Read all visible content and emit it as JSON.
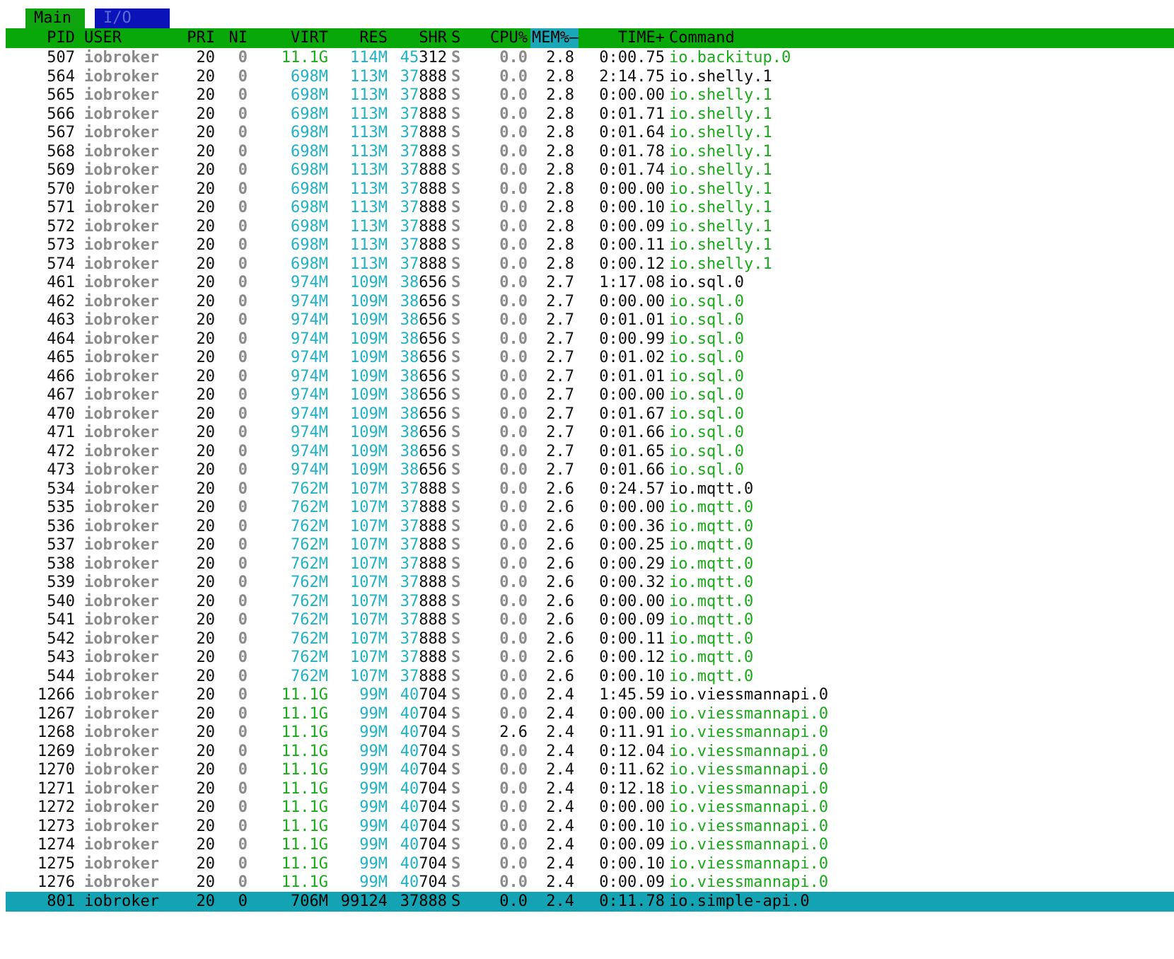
{
  "tabs": {
    "main": "Main",
    "io": "I/O"
  },
  "header": {
    "pid": "PID",
    "user": "USER",
    "pri": "PRI",
    "ni": "NI",
    "virt": "VIRT",
    "res": "RES",
    "shr": "SHR",
    "s": "S",
    "cpu": "CPU%",
    "mem": "MEM%",
    "mem_sort": "–",
    "time": "TIME+",
    "command": "Command"
  },
  "colors": {
    "header_bg": "#08a808",
    "selected_bg": "#14a3b2",
    "tab_main_bg": "#10a410",
    "tab_io_bg": "#0b12b8",
    "thread_green": "#1aa91a",
    "memory_cyan": "#21b1c5",
    "dim_gray": "#8a8a8a"
  },
  "processes": [
    {
      "pid": "507",
      "user": "iobroker",
      "pri": "20",
      "ni": "0",
      "virt": "11.1G",
      "res": "114M",
      "shr": "45312",
      "state": "S",
      "cpu": "0.0",
      "mem": "2.8",
      "time": "0:00.75",
      "command": "io.backitup.0",
      "thread": true
    },
    {
      "pid": "564",
      "user": "iobroker",
      "pri": "20",
      "ni": "0",
      "virt": "698M",
      "res": "113M",
      "shr": "37888",
      "state": "S",
      "cpu": "0.0",
      "mem": "2.8",
      "time": "2:14.75",
      "command": "io.shelly.1",
      "thread": false
    },
    {
      "pid": "565",
      "user": "iobroker",
      "pri": "20",
      "ni": "0",
      "virt": "698M",
      "res": "113M",
      "shr": "37888",
      "state": "S",
      "cpu": "0.0",
      "mem": "2.8",
      "time": "0:00.00",
      "command": "io.shelly.1",
      "thread": true
    },
    {
      "pid": "566",
      "user": "iobroker",
      "pri": "20",
      "ni": "0",
      "virt": "698M",
      "res": "113M",
      "shr": "37888",
      "state": "S",
      "cpu": "0.0",
      "mem": "2.8",
      "time": "0:01.71",
      "command": "io.shelly.1",
      "thread": true
    },
    {
      "pid": "567",
      "user": "iobroker",
      "pri": "20",
      "ni": "0",
      "virt": "698M",
      "res": "113M",
      "shr": "37888",
      "state": "S",
      "cpu": "0.0",
      "mem": "2.8",
      "time": "0:01.64",
      "command": "io.shelly.1",
      "thread": true
    },
    {
      "pid": "568",
      "user": "iobroker",
      "pri": "20",
      "ni": "0",
      "virt": "698M",
      "res": "113M",
      "shr": "37888",
      "state": "S",
      "cpu": "0.0",
      "mem": "2.8",
      "time": "0:01.78",
      "command": "io.shelly.1",
      "thread": true
    },
    {
      "pid": "569",
      "user": "iobroker",
      "pri": "20",
      "ni": "0",
      "virt": "698M",
      "res": "113M",
      "shr": "37888",
      "state": "S",
      "cpu": "0.0",
      "mem": "2.8",
      "time": "0:01.74",
      "command": "io.shelly.1",
      "thread": true
    },
    {
      "pid": "570",
      "user": "iobroker",
      "pri": "20",
      "ni": "0",
      "virt": "698M",
      "res": "113M",
      "shr": "37888",
      "state": "S",
      "cpu": "0.0",
      "mem": "2.8",
      "time": "0:00.00",
      "command": "io.shelly.1",
      "thread": true
    },
    {
      "pid": "571",
      "user": "iobroker",
      "pri": "20",
      "ni": "0",
      "virt": "698M",
      "res": "113M",
      "shr": "37888",
      "state": "S",
      "cpu": "0.0",
      "mem": "2.8",
      "time": "0:00.10",
      "command": "io.shelly.1",
      "thread": true
    },
    {
      "pid": "572",
      "user": "iobroker",
      "pri": "20",
      "ni": "0",
      "virt": "698M",
      "res": "113M",
      "shr": "37888",
      "state": "S",
      "cpu": "0.0",
      "mem": "2.8",
      "time": "0:00.09",
      "command": "io.shelly.1",
      "thread": true
    },
    {
      "pid": "573",
      "user": "iobroker",
      "pri": "20",
      "ni": "0",
      "virt": "698M",
      "res": "113M",
      "shr": "37888",
      "state": "S",
      "cpu": "0.0",
      "mem": "2.8",
      "time": "0:00.11",
      "command": "io.shelly.1",
      "thread": true
    },
    {
      "pid": "574",
      "user": "iobroker",
      "pri": "20",
      "ni": "0",
      "virt": "698M",
      "res": "113M",
      "shr": "37888",
      "state": "S",
      "cpu": "0.0",
      "mem": "2.8",
      "time": "0:00.12",
      "command": "io.shelly.1",
      "thread": true
    },
    {
      "pid": "461",
      "user": "iobroker",
      "pri": "20",
      "ni": "0",
      "virt": "974M",
      "res": "109M",
      "shr": "38656",
      "state": "S",
      "cpu": "0.0",
      "mem": "2.7",
      "time": "1:17.08",
      "command": "io.sql.0",
      "thread": false
    },
    {
      "pid": "462",
      "user": "iobroker",
      "pri": "20",
      "ni": "0",
      "virt": "974M",
      "res": "109M",
      "shr": "38656",
      "state": "S",
      "cpu": "0.0",
      "mem": "2.7",
      "time": "0:00.00",
      "command": "io.sql.0",
      "thread": true
    },
    {
      "pid": "463",
      "user": "iobroker",
      "pri": "20",
      "ni": "0",
      "virt": "974M",
      "res": "109M",
      "shr": "38656",
      "state": "S",
      "cpu": "0.0",
      "mem": "2.7",
      "time": "0:01.01",
      "command": "io.sql.0",
      "thread": true
    },
    {
      "pid": "464",
      "user": "iobroker",
      "pri": "20",
      "ni": "0",
      "virt": "974M",
      "res": "109M",
      "shr": "38656",
      "state": "S",
      "cpu": "0.0",
      "mem": "2.7",
      "time": "0:00.99",
      "command": "io.sql.0",
      "thread": true
    },
    {
      "pid": "465",
      "user": "iobroker",
      "pri": "20",
      "ni": "0",
      "virt": "974M",
      "res": "109M",
      "shr": "38656",
      "state": "S",
      "cpu": "0.0",
      "mem": "2.7",
      "time": "0:01.02",
      "command": "io.sql.0",
      "thread": true
    },
    {
      "pid": "466",
      "user": "iobroker",
      "pri": "20",
      "ni": "0",
      "virt": "974M",
      "res": "109M",
      "shr": "38656",
      "state": "S",
      "cpu": "0.0",
      "mem": "2.7",
      "time": "0:01.01",
      "command": "io.sql.0",
      "thread": true
    },
    {
      "pid": "467",
      "user": "iobroker",
      "pri": "20",
      "ni": "0",
      "virt": "974M",
      "res": "109M",
      "shr": "38656",
      "state": "S",
      "cpu": "0.0",
      "mem": "2.7",
      "time": "0:00.00",
      "command": "io.sql.0",
      "thread": true
    },
    {
      "pid": "470",
      "user": "iobroker",
      "pri": "20",
      "ni": "0",
      "virt": "974M",
      "res": "109M",
      "shr": "38656",
      "state": "S",
      "cpu": "0.0",
      "mem": "2.7",
      "time": "0:01.67",
      "command": "io.sql.0",
      "thread": true
    },
    {
      "pid": "471",
      "user": "iobroker",
      "pri": "20",
      "ni": "0",
      "virt": "974M",
      "res": "109M",
      "shr": "38656",
      "state": "S",
      "cpu": "0.0",
      "mem": "2.7",
      "time": "0:01.66",
      "command": "io.sql.0",
      "thread": true
    },
    {
      "pid": "472",
      "user": "iobroker",
      "pri": "20",
      "ni": "0",
      "virt": "974M",
      "res": "109M",
      "shr": "38656",
      "state": "S",
      "cpu": "0.0",
      "mem": "2.7",
      "time": "0:01.65",
      "command": "io.sql.0",
      "thread": true
    },
    {
      "pid": "473",
      "user": "iobroker",
      "pri": "20",
      "ni": "0",
      "virt": "974M",
      "res": "109M",
      "shr": "38656",
      "state": "S",
      "cpu": "0.0",
      "mem": "2.7",
      "time": "0:01.66",
      "command": "io.sql.0",
      "thread": true
    },
    {
      "pid": "534",
      "user": "iobroker",
      "pri": "20",
      "ni": "0",
      "virt": "762M",
      "res": "107M",
      "shr": "37888",
      "state": "S",
      "cpu": "0.0",
      "mem": "2.6",
      "time": "0:24.57",
      "command": "io.mqtt.0",
      "thread": false
    },
    {
      "pid": "535",
      "user": "iobroker",
      "pri": "20",
      "ni": "0",
      "virt": "762M",
      "res": "107M",
      "shr": "37888",
      "state": "S",
      "cpu": "0.0",
      "mem": "2.6",
      "time": "0:00.00",
      "command": "io.mqtt.0",
      "thread": true
    },
    {
      "pid": "536",
      "user": "iobroker",
      "pri": "20",
      "ni": "0",
      "virt": "762M",
      "res": "107M",
      "shr": "37888",
      "state": "S",
      "cpu": "0.0",
      "mem": "2.6",
      "time": "0:00.36",
      "command": "io.mqtt.0",
      "thread": true
    },
    {
      "pid": "537",
      "user": "iobroker",
      "pri": "20",
      "ni": "0",
      "virt": "762M",
      "res": "107M",
      "shr": "37888",
      "state": "S",
      "cpu": "0.0",
      "mem": "2.6",
      "time": "0:00.25",
      "command": "io.mqtt.0",
      "thread": true
    },
    {
      "pid": "538",
      "user": "iobroker",
      "pri": "20",
      "ni": "0",
      "virt": "762M",
      "res": "107M",
      "shr": "37888",
      "state": "S",
      "cpu": "0.0",
      "mem": "2.6",
      "time": "0:00.29",
      "command": "io.mqtt.0",
      "thread": true
    },
    {
      "pid": "539",
      "user": "iobroker",
      "pri": "20",
      "ni": "0",
      "virt": "762M",
      "res": "107M",
      "shr": "37888",
      "state": "S",
      "cpu": "0.0",
      "mem": "2.6",
      "time": "0:00.32",
      "command": "io.mqtt.0",
      "thread": true
    },
    {
      "pid": "540",
      "user": "iobroker",
      "pri": "20",
      "ni": "0",
      "virt": "762M",
      "res": "107M",
      "shr": "37888",
      "state": "S",
      "cpu": "0.0",
      "mem": "2.6",
      "time": "0:00.00",
      "command": "io.mqtt.0",
      "thread": true
    },
    {
      "pid": "541",
      "user": "iobroker",
      "pri": "20",
      "ni": "0",
      "virt": "762M",
      "res": "107M",
      "shr": "37888",
      "state": "S",
      "cpu": "0.0",
      "mem": "2.6",
      "time": "0:00.09",
      "command": "io.mqtt.0",
      "thread": true
    },
    {
      "pid": "542",
      "user": "iobroker",
      "pri": "20",
      "ni": "0",
      "virt": "762M",
      "res": "107M",
      "shr": "37888",
      "state": "S",
      "cpu": "0.0",
      "mem": "2.6",
      "time": "0:00.11",
      "command": "io.mqtt.0",
      "thread": true
    },
    {
      "pid": "543",
      "user": "iobroker",
      "pri": "20",
      "ni": "0",
      "virt": "762M",
      "res": "107M",
      "shr": "37888",
      "state": "S",
      "cpu": "0.0",
      "mem": "2.6",
      "time": "0:00.12",
      "command": "io.mqtt.0",
      "thread": true
    },
    {
      "pid": "544",
      "user": "iobroker",
      "pri": "20",
      "ni": "0",
      "virt": "762M",
      "res": "107M",
      "shr": "37888",
      "state": "S",
      "cpu": "0.0",
      "mem": "2.6",
      "time": "0:00.10",
      "command": "io.mqtt.0",
      "thread": true
    },
    {
      "pid": "1266",
      "user": "iobroker",
      "pri": "20",
      "ni": "0",
      "virt": "11.1G",
      "res": "99M",
      "shr": "40704",
      "state": "S",
      "cpu": "0.0",
      "mem": "2.4",
      "time": "1:45.59",
      "command": "io.viessmannapi.0",
      "thread": false
    },
    {
      "pid": "1267",
      "user": "iobroker",
      "pri": "20",
      "ni": "0",
      "virt": "11.1G",
      "res": "99M",
      "shr": "40704",
      "state": "S",
      "cpu": "0.0",
      "mem": "2.4",
      "time": "0:00.00",
      "command": "io.viessmannapi.0",
      "thread": true
    },
    {
      "pid": "1268",
      "user": "iobroker",
      "pri": "20",
      "ni": "0",
      "virt": "11.1G",
      "res": "99M",
      "shr": "40704",
      "state": "S",
      "cpu": "2.6",
      "mem": "2.4",
      "time": "0:11.91",
      "command": "io.viessmannapi.0",
      "thread": true
    },
    {
      "pid": "1269",
      "user": "iobroker",
      "pri": "20",
      "ni": "0",
      "virt": "11.1G",
      "res": "99M",
      "shr": "40704",
      "state": "S",
      "cpu": "0.0",
      "mem": "2.4",
      "time": "0:12.04",
      "command": "io.viessmannapi.0",
      "thread": true
    },
    {
      "pid": "1270",
      "user": "iobroker",
      "pri": "20",
      "ni": "0",
      "virt": "11.1G",
      "res": "99M",
      "shr": "40704",
      "state": "S",
      "cpu": "0.0",
      "mem": "2.4",
      "time": "0:11.62",
      "command": "io.viessmannapi.0",
      "thread": true
    },
    {
      "pid": "1271",
      "user": "iobroker",
      "pri": "20",
      "ni": "0",
      "virt": "11.1G",
      "res": "99M",
      "shr": "40704",
      "state": "S",
      "cpu": "0.0",
      "mem": "2.4",
      "time": "0:12.18",
      "command": "io.viessmannapi.0",
      "thread": true
    },
    {
      "pid": "1272",
      "user": "iobroker",
      "pri": "20",
      "ni": "0",
      "virt": "11.1G",
      "res": "99M",
      "shr": "40704",
      "state": "S",
      "cpu": "0.0",
      "mem": "2.4",
      "time": "0:00.00",
      "command": "io.viessmannapi.0",
      "thread": true
    },
    {
      "pid": "1273",
      "user": "iobroker",
      "pri": "20",
      "ni": "0",
      "virt": "11.1G",
      "res": "99M",
      "shr": "40704",
      "state": "S",
      "cpu": "0.0",
      "mem": "2.4",
      "time": "0:00.10",
      "command": "io.viessmannapi.0",
      "thread": true
    },
    {
      "pid": "1274",
      "user": "iobroker",
      "pri": "20",
      "ni": "0",
      "virt": "11.1G",
      "res": "99M",
      "shr": "40704",
      "state": "S",
      "cpu": "0.0",
      "mem": "2.4",
      "time": "0:00.09",
      "command": "io.viessmannapi.0",
      "thread": true
    },
    {
      "pid": "1275",
      "user": "iobroker",
      "pri": "20",
      "ni": "0",
      "virt": "11.1G",
      "res": "99M",
      "shr": "40704",
      "state": "S",
      "cpu": "0.0",
      "mem": "2.4",
      "time": "0:00.10",
      "command": "io.viessmannapi.0",
      "thread": true
    },
    {
      "pid": "1276",
      "user": "iobroker",
      "pri": "20",
      "ni": "0",
      "virt": "11.1G",
      "res": "99M",
      "shr": "40704",
      "state": "S",
      "cpu": "0.0",
      "mem": "2.4",
      "time": "0:00.09",
      "command": "io.viessmannapi.0",
      "thread": true
    },
    {
      "pid": "801",
      "user": "iobroker",
      "pri": "20",
      "ni": "0",
      "virt": "706M",
      "res": "99124",
      "shr": "37888",
      "state": "S",
      "cpu": "0.0",
      "mem": "2.4",
      "time": "0:11.78",
      "command": "io.simple-api.0",
      "thread": false,
      "selected": true
    }
  ]
}
